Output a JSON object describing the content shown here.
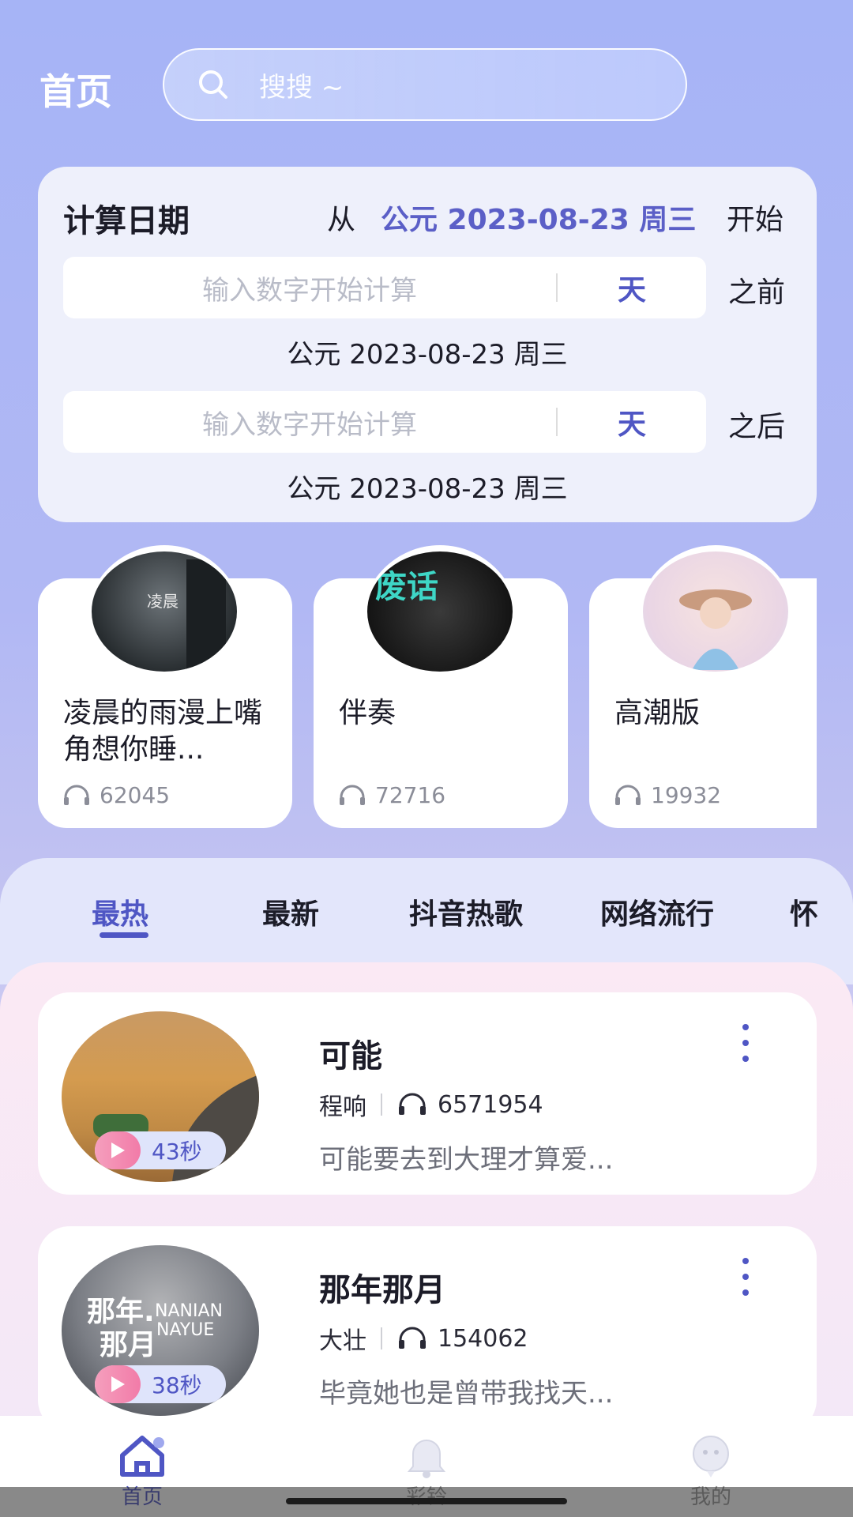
{
  "header": {
    "title": "首页",
    "search_placeholder": "搜搜 ~"
  },
  "calculator": {
    "title": "计算日期",
    "from_label": "从",
    "base_date": "公元 2023-08-23 周三",
    "start_label": "开始",
    "before": {
      "placeholder": "输入数字开始计算",
      "unit": "天",
      "label": "之前",
      "result": "公元 2023-08-23 周三"
    },
    "after": {
      "placeholder": "输入数字开始计算",
      "unit": "天",
      "label": "之后",
      "result": "公元 2023-08-23 周三"
    }
  },
  "featured": [
    {
      "name": "凌晨的雨漫上嘴角想你睡...",
      "plays": "62045",
      "cover_text": "凌晨"
    },
    {
      "name": "伴奏",
      "plays": "72716",
      "cover_text": "废话"
    },
    {
      "name": "高潮版",
      "plays": "19932",
      "cover_text": ""
    }
  ],
  "tabs": [
    "最热",
    "最新",
    "抖音热歌",
    "网络流行",
    "怀"
  ],
  "active_tab": "最热",
  "songs": [
    {
      "title": "可能",
      "artist": "程响",
      "plays": "6571954",
      "desc": "可能要去到大理才算爱...",
      "duration": "43秒"
    },
    {
      "title": "那年那月",
      "artist": "大壮",
      "plays": "154062",
      "desc": "毕竟她也是曾带我找天...",
      "duration": "38秒",
      "cover_text_1": "那年.",
      "cover_text_2": "那月",
      "cover_text_3": "NANIAN",
      "cover_text_4": "NAYUE"
    }
  ],
  "nav": {
    "home": "首页",
    "ringtone": "彩铃",
    "mine": "我的"
  },
  "colors": {
    "accent": "#4f56c4",
    "play_pink": "#f27ba8"
  }
}
